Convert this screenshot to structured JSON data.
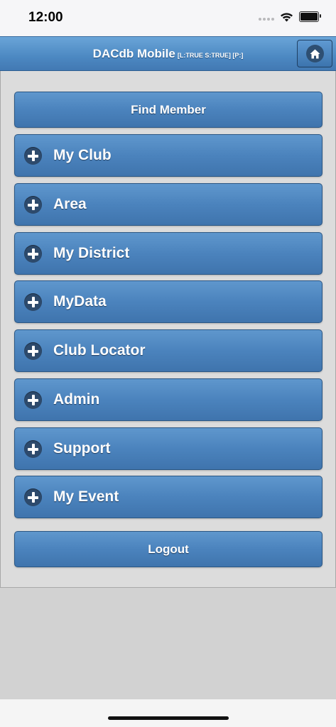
{
  "status_bar": {
    "time": "12:00"
  },
  "header": {
    "title": "DACdb Mobile",
    "subtitle": "[L:TRUE S:TRUE] [P:]",
    "home_icon": "home-icon"
  },
  "buttons": {
    "find_member": "Find Member",
    "logout": "Logout"
  },
  "menu": {
    "items": [
      {
        "label": "My Club",
        "icon": "plus-icon"
      },
      {
        "label": "Area",
        "icon": "plus-icon"
      },
      {
        "label": "My District",
        "icon": "plus-icon"
      },
      {
        "label": "MyData",
        "icon": "plus-icon"
      },
      {
        "label": "Club Locator",
        "icon": "plus-icon"
      },
      {
        "label": "Admin",
        "icon": "plus-icon"
      },
      {
        "label": "Support",
        "icon": "plus-icon"
      },
      {
        "label": "My Event",
        "icon": "plus-icon"
      }
    ]
  },
  "colors": {
    "header": "#4c88c2",
    "button": "#4b83bd",
    "background": "#d2d2d2"
  }
}
